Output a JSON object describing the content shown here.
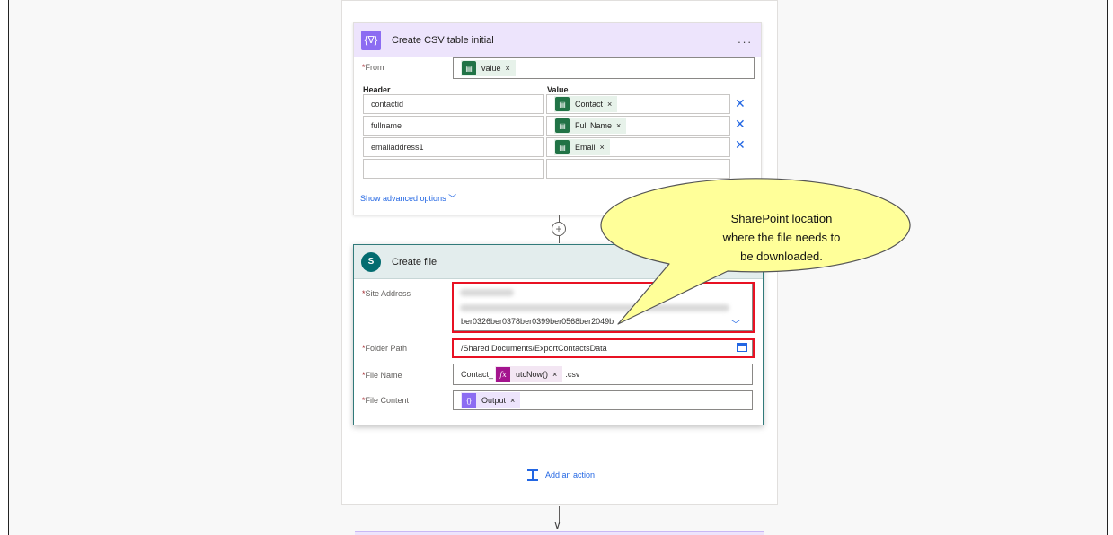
{
  "csv_card": {
    "title": "Create CSV table initial",
    "menu": "...",
    "icon": "curly-braces-icon",
    "icon_glyph": "{∇}",
    "from_label": "From",
    "from_token": "value",
    "header_label": "Header",
    "value_label": "Value",
    "rows": [
      {
        "header": "contactid",
        "value": "Contact"
      },
      {
        "header": "fullname",
        "value": "Full Name"
      },
      {
        "header": "emailaddress1",
        "value": "Email"
      }
    ],
    "advanced": "Show advanced options"
  },
  "file_card": {
    "title": "Create file",
    "icon": "sharepoint-icon",
    "icon_glyph": "S",
    "site_label": "Site Address",
    "site_value": "ber0326ber0378ber0399ber0568ber2049b",
    "folder_label": "Folder Path",
    "folder_value": "/Shared Documents/ExportContactsData",
    "filename_label": "File Name",
    "filename_prefix": "Contact_",
    "filename_token": "utcNow()",
    "filename_suffix": ".csv",
    "content_label": "File Content",
    "content_token": "Output"
  },
  "callout": {
    "line1": "SharePoint location",
    "line2": "where the file needs to",
    "line3": "be downloaded."
  },
  "add_action": "Add an action",
  "colors": {
    "csv_header": "#ede4fc",
    "sharepoint": "#036c70",
    "highlight": "#e81123",
    "callout_fill": "#ffff99"
  }
}
